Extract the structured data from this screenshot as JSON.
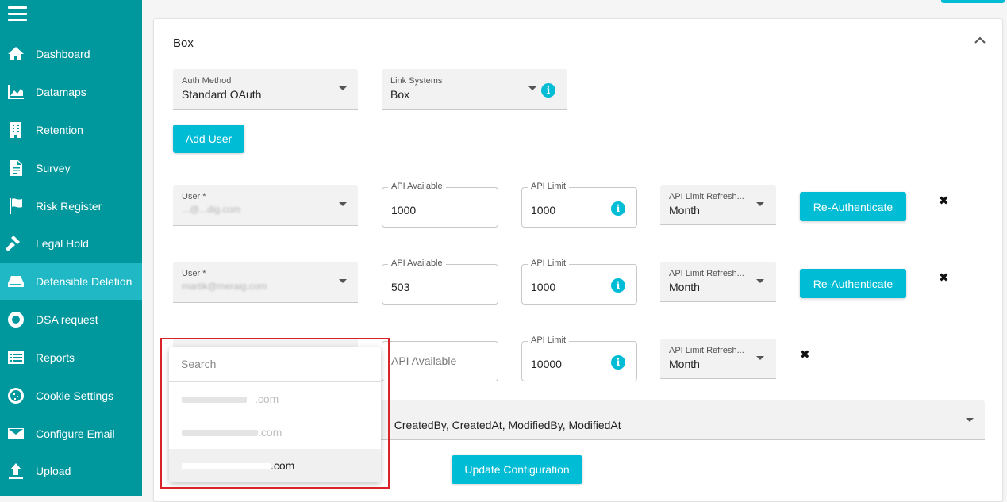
{
  "sidebar": {
    "items": [
      {
        "label": "Dashboard",
        "icon": "home-icon"
      },
      {
        "label": "Datamaps",
        "icon": "area-chart-icon"
      },
      {
        "label": "Retention",
        "icon": "building-icon"
      },
      {
        "label": "Survey",
        "icon": "document-icon"
      },
      {
        "label": "Risk Register",
        "icon": "flag-icon"
      },
      {
        "label": "Legal Hold",
        "icon": "gavel-icon"
      },
      {
        "label": "Defensible Deletion",
        "icon": "drive-icon",
        "active": true
      },
      {
        "label": "DSA request",
        "icon": "lifebuoy-icon"
      },
      {
        "label": "Reports",
        "icon": "list-icon"
      },
      {
        "label": "Cookie Settings",
        "icon": "cookie-icon"
      },
      {
        "label": "Configure Email",
        "icon": "envelope-icon"
      },
      {
        "label": "Upload",
        "icon": "upload-icon"
      }
    ]
  },
  "card": {
    "title": "Box",
    "auth_method": {
      "label": "Auth Method",
      "value": "Standard OAuth"
    },
    "link_systems": {
      "label": "Link Systems",
      "value": "Box"
    },
    "add_user_label": "Add User"
  },
  "users": [
    {
      "user_label": "User *",
      "user_value": "...@...dig.com",
      "api_available_label": "API Available",
      "api_available": "1000",
      "api_limit_label": "API Limit",
      "api_limit": "1000",
      "refresh_label": "API Limit Refresh...",
      "refresh_value": "Month",
      "reauth_label": "Re-Authenticate"
    },
    {
      "user_label": "User *",
      "user_value": "martik@meraig.com",
      "api_available_label": "API Available",
      "api_available": "503",
      "api_limit_label": "API Limit",
      "api_limit": "1000",
      "refresh_label": "API Limit Refresh...",
      "refresh_value": "Month",
      "reauth_label": "Re-Authenticate"
    },
    {
      "api_available_placeholder": "API Available",
      "api_limit_label": "API Limit",
      "api_limit": "10000",
      "refresh_label": "API Limit Refresh...",
      "refresh_value": "Month"
    }
  ],
  "fields_value": ", CreatedBy, CreatedAt, ModifiedBy, ModifiedAt",
  "update_label": "Update Configuration",
  "dropdown": {
    "search_placeholder": "Search",
    "options": [
      ".com",
      ".com",
      ".com"
    ]
  },
  "colors": {
    "sidebar": "#00979d",
    "active": "#20b8c4",
    "accent": "#00bcd4",
    "highlight": "#d9222a"
  }
}
